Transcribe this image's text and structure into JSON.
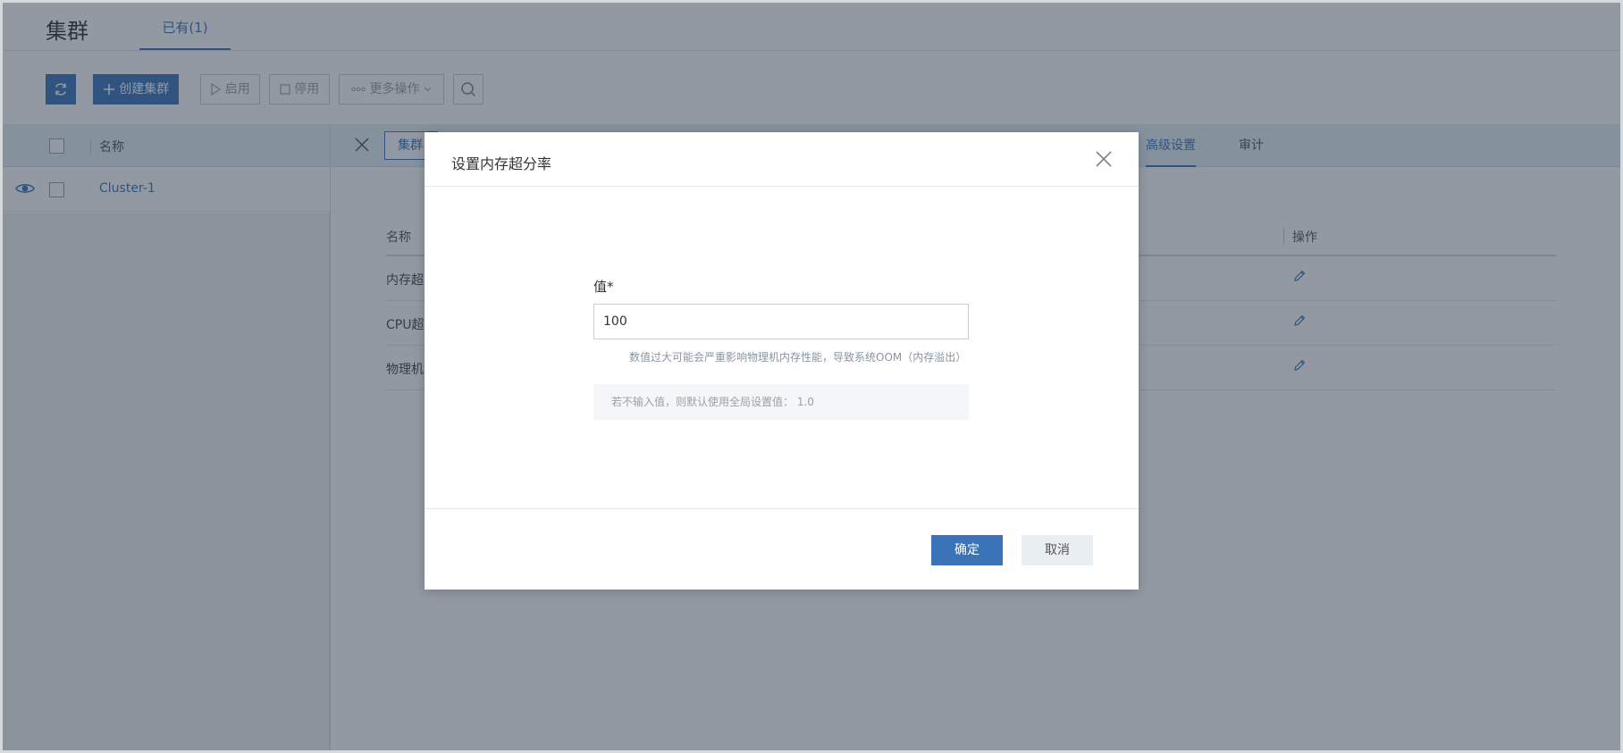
{
  "header": {
    "title": "集群",
    "tab_label": "已有(1)"
  },
  "toolbar": {
    "refresh_icon": "refresh-icon",
    "create_label": "创建集群",
    "start_label": "启用",
    "stop_label": "停用",
    "more_label": "更多操作",
    "search_icon": "search-icon"
  },
  "list": {
    "column_name": "名称",
    "rows": [
      {
        "name": "Cluster-1"
      }
    ]
  },
  "detail": {
    "tabs": {
      "cluster": "集群",
      "advanced": "高级设置",
      "audit": "审计"
    },
    "table": {
      "col_name": "名称",
      "col_op": "操作",
      "rows": [
        {
          "name": "内存超"
        },
        {
          "name": "CPU超"
        },
        {
          "name": "物理机"
        }
      ]
    }
  },
  "modal": {
    "title": "设置内存超分率",
    "field_label": "值*",
    "field_value": "100",
    "warning": "数值过大可能会严重影响物理机内存性能，导致系统OOM（内存溢出）",
    "tip": "若不输入值，则默认使用全局设置值：  1.0",
    "ok_label": "确定",
    "cancel_label": "取消"
  },
  "colors": {
    "primary": "#3b73b9",
    "overlay": "#263446"
  }
}
